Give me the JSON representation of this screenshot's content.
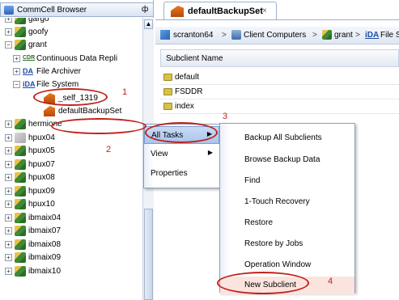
{
  "browser": {
    "title": "CommCell Browser",
    "pin_glyph": "ф",
    "tree": [
      {
        "label": "gargo",
        "icon": "server-icon",
        "expander": "+"
      },
      {
        "label": "goofy",
        "icon": "server-icon",
        "expander": "+"
      },
      {
        "label": "grant",
        "icon": "server-icon",
        "expander": "−"
      },
      {
        "label": "Continuous Data Repli",
        "icon": "cdr-agent-icon",
        "expander": "+"
      },
      {
        "label": "File Archiver",
        "icon": "ida-icon",
        "expander": "+"
      },
      {
        "label": "File System",
        "icon": "ida-icon",
        "expander": "−"
      },
      {
        "label": "_self_1319",
        "icon": "backupset-icon",
        "expander": ""
      },
      {
        "label": "defaultBackupSet",
        "icon": "backupset-icon",
        "expander": ""
      },
      {
        "label": "hermione",
        "icon": "server-icon",
        "expander": "+"
      },
      {
        "label": "hpux04",
        "icon": "server-offline-icon",
        "expander": "+"
      },
      {
        "label": "hpux05",
        "icon": "server-icon",
        "expander": "+"
      },
      {
        "label": "hpux07",
        "icon": "server-icon",
        "expander": "+"
      },
      {
        "label": "hpux08",
        "icon": "server-icon",
        "expander": "+"
      },
      {
        "label": "hpux09",
        "icon": "server-icon",
        "expander": "+"
      },
      {
        "label": "hpux10",
        "icon": "server-icon",
        "expander": "+"
      },
      {
        "label": "ibmaix04",
        "icon": "server-icon",
        "expander": "+"
      },
      {
        "label": "ibmaix07",
        "icon": "server-icon",
        "expander": "+"
      },
      {
        "label": "ibmaix08",
        "icon": "server-icon",
        "expander": "+"
      },
      {
        "label": "ibmaix09",
        "icon": "server-icon",
        "expander": "+"
      },
      {
        "label": "ibmaix10",
        "icon": "server-icon",
        "expander": "+"
      }
    ]
  },
  "tab": {
    "label": "defaultBackupSet",
    "close": "×"
  },
  "breadcrumb": {
    "items": [
      "scranton64",
      "Client Computers",
      "grant",
      "File S"
    ],
    "separator": ">"
  },
  "grid": {
    "header": "Subclient Name",
    "rows": [
      "default",
      "FSDDR",
      "index"
    ]
  },
  "context_menu": {
    "items": [
      {
        "label": "All Tasks",
        "has_submenu": true
      },
      {
        "label": "View",
        "has_submenu": true
      },
      {
        "label": "Properties",
        "has_submenu": false
      }
    ]
  },
  "submenu": {
    "items": [
      "Backup All Subclients",
      "Browse Backup Data",
      "Find",
      "1-Touch Recovery",
      "Restore",
      "Restore by Jobs",
      "Operation Window",
      "New Subclient"
    ]
  },
  "callouts": [
    "1",
    "2",
    "3",
    "4"
  ],
  "colors": {
    "callout": "#c0221c",
    "highlight": "#a9c4ec",
    "tree_border": "#9bb0cf"
  }
}
